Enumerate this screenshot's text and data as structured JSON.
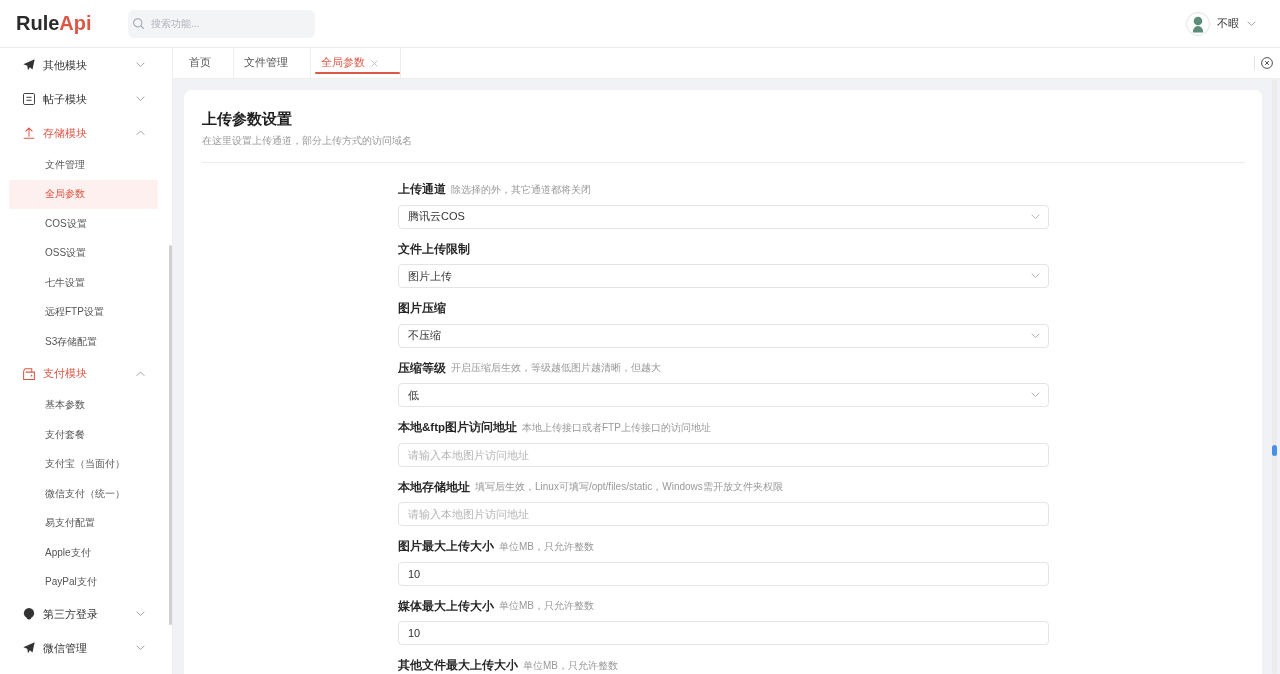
{
  "header": {
    "logo": {
      "dark_part": "Rule",
      "accent_part": "Api"
    },
    "search": {
      "placeholder": "搜索功能..."
    },
    "user": {
      "name": "不暇"
    }
  },
  "sidebar": {
    "items": [
      {
        "label": "其他模块",
        "expanded": false
      },
      {
        "label": "帖子模块",
        "expanded": false
      },
      {
        "label": "存储模块",
        "expanded": true,
        "children": [
          {
            "label": "文件管理",
            "selected": false
          },
          {
            "label": "全局参数",
            "selected": true
          },
          {
            "label": "COS设置",
            "selected": false
          },
          {
            "label": "OSS设置",
            "selected": false
          },
          {
            "label": "七牛设置",
            "selected": false
          },
          {
            "label": "远程FTP设置",
            "selected": false
          },
          {
            "label": "S3存储配置",
            "selected": false
          }
        ]
      },
      {
        "label": "支付模块",
        "expanded": true,
        "children": [
          {
            "label": "基本参数",
            "selected": false
          },
          {
            "label": "支付套餐",
            "selected": false
          },
          {
            "label": "支付宝（当面付）",
            "selected": false
          },
          {
            "label": "微信支付（统一）",
            "selected": false
          },
          {
            "label": "易支付配置",
            "selected": false
          },
          {
            "label": "Apple支付",
            "selected": false
          },
          {
            "label": "PayPal支付",
            "selected": false
          }
        ]
      },
      {
        "label": "第三方登录",
        "expanded": false
      },
      {
        "label": "微信管理",
        "expanded": false
      }
    ]
  },
  "tabs": [
    {
      "label": "首页",
      "selected": false,
      "closable": false
    },
    {
      "label": "文件管理",
      "selected": false,
      "closable": false
    },
    {
      "label": "全局参数",
      "selected": true,
      "closable": true
    }
  ],
  "page": {
    "title": "上传参数设置",
    "subtitle": "在这里设置上传通道，部分上传方式的访问域名"
  },
  "form": {
    "fields": [
      {
        "kind": "select",
        "label": "上传通道",
        "hint": "除选择的外，其它通道都将关闭",
        "value": "腾讯云COS"
      },
      {
        "kind": "select",
        "label": "文件上传限制",
        "value": "图片上传"
      },
      {
        "kind": "select",
        "label": "图片压缩",
        "value": "不压缩"
      },
      {
        "kind": "select",
        "label": "压缩等级",
        "hint": "开启压缩后生效，等级越低图片越清晰，但越大",
        "value": "低"
      },
      {
        "kind": "input",
        "label": "本地&ftp图片访问地址",
        "hint": "本地上传接口或者FTP上传接口的访问地址",
        "placeholder": "请输入本地图片访问地址"
      },
      {
        "kind": "input",
        "label": "本地存储地址",
        "hint": "填写后生效，Linux可填写/opt/files/static，Windows需开放文件夹权限",
        "placeholder": "请输入本地图片访问地址"
      },
      {
        "kind": "input",
        "label": "图片最大上传大小",
        "hint": "单位MB，只允许整数",
        "value": "10"
      },
      {
        "kind": "input",
        "label": "媒体最大上传大小",
        "hint": "单位MB，只允许整数",
        "value": "10"
      },
      {
        "kind": "label_only",
        "label": "其他文件最大上传大小",
        "hint": "单位MB，只允许整数"
      }
    ]
  }
}
